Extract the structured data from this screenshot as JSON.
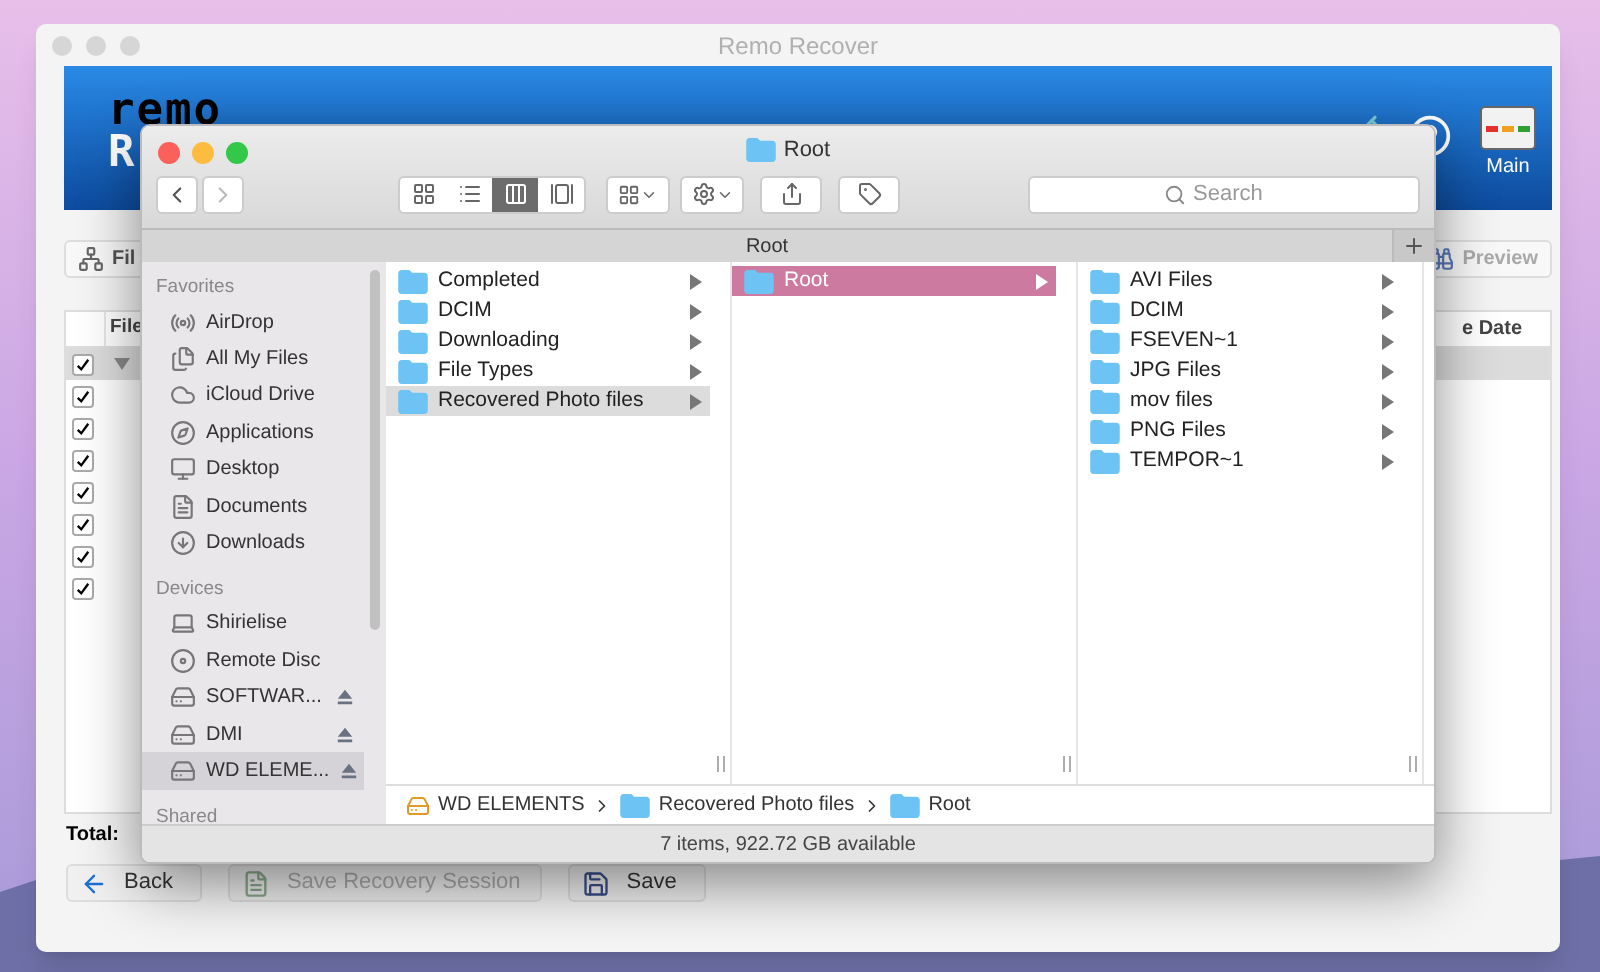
{
  "app_window": {
    "title": "Remo Recover",
    "logo": "remo",
    "logo_fragment": "R",
    "header_buttons": [
      {
        "label": "Main"
      }
    ],
    "toolbar": [
      {
        "label": "Fil"
      },
      {
        "label": "Preview"
      }
    ],
    "table": {
      "columns": [
        "File",
        "e Date"
      ],
      "rows": [
        {
          "kind": "group",
          "expanded": true,
          "checked": true,
          "selected": true
        },
        {
          "kind": "item",
          "checked": true,
          "selected": false
        },
        {
          "kind": "item",
          "checked": true,
          "selected": false
        },
        {
          "kind": "item",
          "checked": true,
          "selected": false
        },
        {
          "kind": "item",
          "checked": true,
          "selected": false
        },
        {
          "kind": "item",
          "checked": true,
          "selected": false
        },
        {
          "kind": "item",
          "checked": true,
          "selected": false
        },
        {
          "kind": "item",
          "checked": true,
          "selected": false
        }
      ]
    },
    "total_label": "Total:",
    "buttons": [
      {
        "label": "Back",
        "disabled": false
      },
      {
        "label": "Save Recovery Session",
        "disabled": true
      },
      {
        "label": "Save",
        "disabled": false
      }
    ]
  },
  "finder": {
    "title": "Root",
    "view_modes": [
      {
        "selected": false
      },
      {
        "selected": false
      },
      {
        "selected": true
      },
      {
        "selected": false
      }
    ],
    "search": {
      "placeholder": "Search"
    },
    "tab": "Root",
    "sidebar": [
      {
        "title": "Favorites",
        "items": [
          {
            "label": "AirDrop",
            "selected": false,
            "ejectable": false
          },
          {
            "label": "All My Files",
            "selected": false,
            "ejectable": false
          },
          {
            "label": "iCloud Drive",
            "selected": false,
            "ejectable": false
          },
          {
            "label": "Applications",
            "selected": false,
            "ejectable": false
          },
          {
            "label": "Desktop",
            "selected": false,
            "ejectable": false
          },
          {
            "label": "Documents",
            "selected": false,
            "ejectable": false
          },
          {
            "label": "Downloads",
            "selected": false,
            "ejectable": false
          }
        ]
      },
      {
        "title": "Devices",
        "items": [
          {
            "label": "Shirielise",
            "selected": false,
            "ejectable": false
          },
          {
            "label": "Remote Disc",
            "selected": false,
            "ejectable": false
          },
          {
            "label": "SOFTWAR...",
            "selected": false,
            "ejectable": true
          },
          {
            "label": "DMI",
            "selected": false,
            "ejectable": true
          },
          {
            "label": "WD ELEME...",
            "selected": true,
            "ejectable": true
          }
        ]
      },
      {
        "title": "Shared"
      }
    ],
    "columns": [
      {
        "items": [
          {
            "label": "Completed",
            "selected": false
          },
          {
            "label": "DCIM",
            "selected": false
          },
          {
            "label": "Downloading",
            "selected": false
          },
          {
            "label": "File Types",
            "selected": false
          },
          {
            "label": "Recovered Photo files",
            "selected": true
          }
        ]
      },
      {
        "items": [
          {
            "label": "Root",
            "selected": true
          }
        ]
      },
      {
        "items": [
          {
            "label": "AVI Files",
            "selected": false
          },
          {
            "label": "DCIM",
            "selected": false
          },
          {
            "label": "FSEVEN~1",
            "selected": false
          },
          {
            "label": "JPG Files",
            "selected": false
          },
          {
            "label": "mov files",
            "selected": false
          },
          {
            "label": "PNG Files",
            "selected": false
          },
          {
            "label": "TEMPOR~1",
            "selected": false
          }
        ]
      }
    ],
    "path": [
      {
        "label": "WD ELEMENTS"
      },
      {
        "label": "Recovered Photo files"
      },
      {
        "label": "Root"
      }
    ],
    "status": "7 items, 922.72 GB available"
  }
}
